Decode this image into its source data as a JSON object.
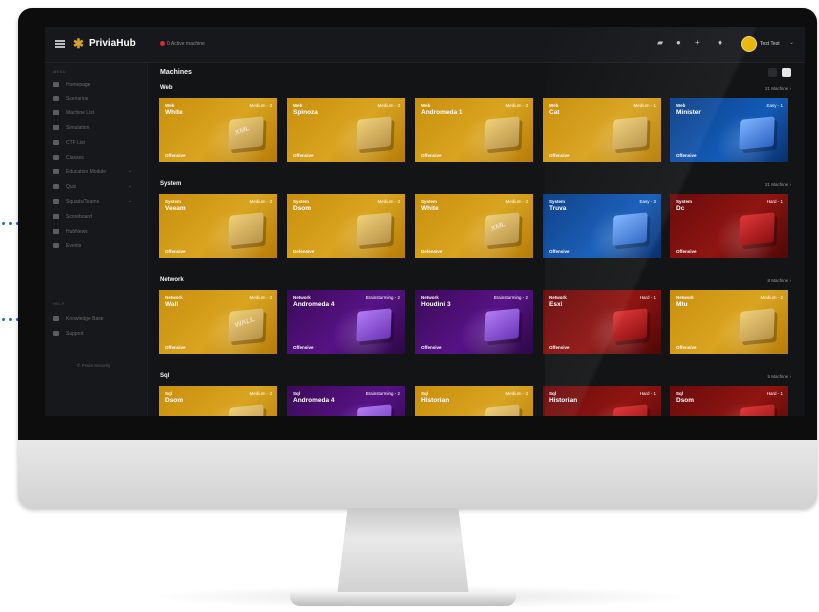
{
  "app": {
    "brand": "PriviaHub",
    "active_machine": "0 Active machine",
    "user_name": "Test Test"
  },
  "sidebar": {
    "sections": [
      "MENU",
      "HELP"
    ],
    "items": [
      {
        "label": "Homepage",
        "has_caret": false
      },
      {
        "label": "Scenarios",
        "has_caret": false
      },
      {
        "label": "Machine List",
        "has_caret": false
      },
      {
        "label": "Simulation",
        "has_caret": false
      },
      {
        "label": "CTF List",
        "has_caret": false
      },
      {
        "label": "Classes",
        "has_caret": false
      },
      {
        "label": "Education Module",
        "has_caret": true
      },
      {
        "label": "Quiz",
        "has_caret": true
      },
      {
        "label": "Squads/Teams",
        "has_caret": true
      },
      {
        "label": "Scoreboard",
        "has_caret": false
      },
      {
        "label": "HubNews",
        "has_caret": false
      },
      {
        "label": "Events",
        "has_caret": false
      },
      {
        "label": "Knowledge Base",
        "has_caret": false
      },
      {
        "label": "Support",
        "has_caret": false
      }
    ],
    "footer": "© Privia Security"
  },
  "main": {
    "title": "Machines",
    "sections": [
      {
        "title": "Web",
        "count": "21 Machine",
        "cards": [
          {
            "category": "Web",
            "name": "White",
            "difficulty": "Medium - 3",
            "type": "Offensive",
            "color": "gold",
            "art": "XML"
          },
          {
            "category": "Web",
            "name": "Spinoza",
            "difficulty": "Medium - 3",
            "type": "Offensive",
            "color": "gold",
            "art": ""
          },
          {
            "category": "Web",
            "name": "Andromeda 1",
            "difficulty": "Medium - 3",
            "type": "Offensive",
            "color": "gold",
            "art": ""
          },
          {
            "category": "Web",
            "name": "Cat",
            "difficulty": "Medium - 1",
            "type": "Offensive",
            "color": "gold",
            "art": ""
          },
          {
            "category": "Web",
            "name": "Minister",
            "difficulty": "Easy - 1",
            "type": "Offensive",
            "color": "blue",
            "art": ""
          }
        ]
      },
      {
        "title": "System",
        "count": "21 Machine",
        "cards": [
          {
            "category": "System",
            "name": "Veeam",
            "difficulty": "Medium - 3",
            "type": "Offensive",
            "color": "gold",
            "art": ""
          },
          {
            "category": "System",
            "name": "Dsom",
            "difficulty": "Medium - 3",
            "type": "Defensive",
            "color": "gold",
            "art": ""
          },
          {
            "category": "System",
            "name": "White",
            "difficulty": "Medium - 3",
            "type": "Defensive",
            "color": "gold",
            "art": "XML"
          },
          {
            "category": "System",
            "name": "Truva",
            "difficulty": "Easy - 3",
            "type": "Offensive",
            "color": "blue",
            "art": ""
          },
          {
            "category": "System",
            "name": "Dc",
            "difficulty": "Hard - 1",
            "type": "Offensive",
            "color": "red",
            "art": ""
          }
        ]
      },
      {
        "title": "Network",
        "count": "8 Machine",
        "cards": [
          {
            "category": "Network",
            "name": "Wall",
            "difficulty": "Medium - 3",
            "type": "Offensive",
            "color": "gold",
            "art": "WALL"
          },
          {
            "category": "Network",
            "name": "Andromeda 4",
            "difficulty": "Brainstorming - 2",
            "type": "Offensive",
            "color": "purple",
            "art": ""
          },
          {
            "category": "Network",
            "name": "Houdini 3",
            "difficulty": "Brainstorming - 2",
            "type": "Offensive",
            "color": "purple",
            "art": ""
          },
          {
            "category": "Network",
            "name": "Esxi",
            "difficulty": "Hard - 1",
            "type": "Offensive",
            "color": "red",
            "art": ""
          },
          {
            "category": "Network",
            "name": "Mtu",
            "difficulty": "Medium - 2",
            "type": "Offensive",
            "color": "gold",
            "art": ""
          }
        ]
      },
      {
        "title": "Sql",
        "count": "5 Machine",
        "cards": [
          {
            "category": "Sql",
            "name": "Dsom",
            "difficulty": "Medium - 3",
            "type": "",
            "color": "gold",
            "art": ""
          },
          {
            "category": "Sql",
            "name": "Andromeda 4",
            "difficulty": "Brainstorming - 2",
            "type": "",
            "color": "purple",
            "art": ""
          },
          {
            "category": "Sql",
            "name": "Historian",
            "difficulty": "Medium - 3",
            "type": "",
            "color": "gold",
            "art": ""
          },
          {
            "category": "Sql",
            "name": "Historian",
            "difficulty": "Hard - 1",
            "type": "",
            "color": "red",
            "art": ""
          },
          {
            "category": "Sql",
            "name": "Dsom",
            "difficulty": "Hard - 1",
            "type": "",
            "color": "red",
            "art": ""
          }
        ]
      }
    ]
  },
  "colors": {
    "gold": "#d39a18",
    "blue": "#135bb8",
    "red": "#8f1512",
    "purple": "#571386",
    "accent_dots": "#2b6cd8",
    "avatar": "#e7b70a",
    "active_dot": "#d6263a"
  },
  "icons": {
    "menu": "hamburger-icon",
    "theme": "mode-toggle-icon",
    "help": "help-icon",
    "add": "plus-icon",
    "notifications": "bell-icon"
  }
}
